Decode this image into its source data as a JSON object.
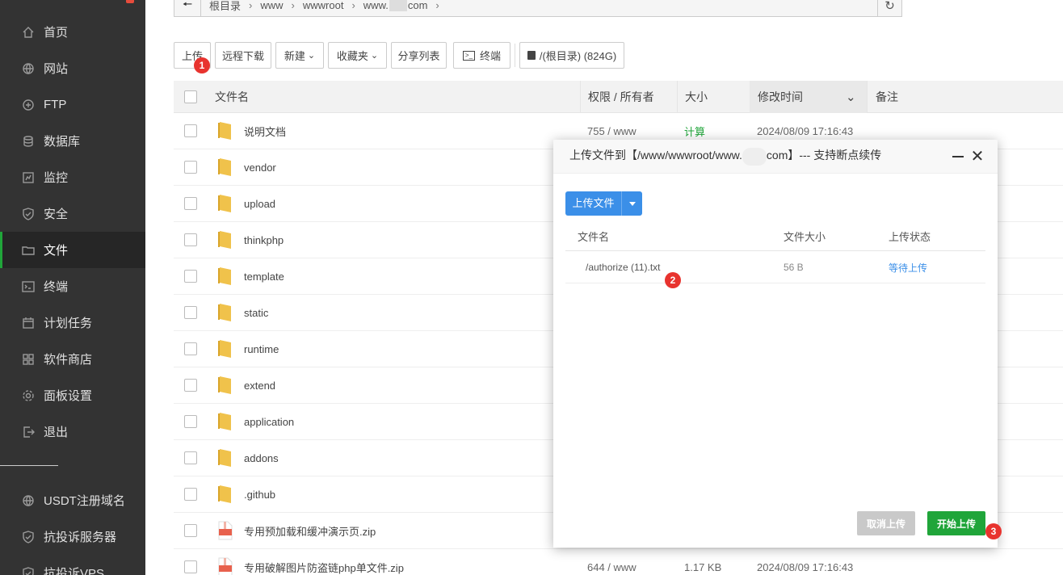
{
  "sidebar": {
    "items": [
      {
        "label": "首页",
        "icon": "home-icon"
      },
      {
        "label": "网站",
        "icon": "globe-icon"
      },
      {
        "label": "FTP",
        "icon": "ftp-icon"
      },
      {
        "label": "数据库",
        "icon": "database-icon"
      },
      {
        "label": "监控",
        "icon": "monitor-icon"
      },
      {
        "label": "安全",
        "icon": "shield-icon"
      },
      {
        "label": "文件",
        "icon": "folder-icon"
      },
      {
        "label": "终端",
        "icon": "terminal-icon"
      },
      {
        "label": "计划任务",
        "icon": "calendar-icon"
      },
      {
        "label": "软件商店",
        "icon": "apps-icon"
      },
      {
        "label": "面板设置",
        "icon": "gear-icon"
      },
      {
        "label": "退出",
        "icon": "logout-icon"
      },
      {
        "label": "USDT注册域名",
        "icon": "globe-icon"
      },
      {
        "label": "抗投诉服务器",
        "icon": "shield-icon"
      },
      {
        "label": "抗投诉VPS",
        "icon": "shield-icon"
      }
    ],
    "active_index": 6,
    "accent_color": "#20a53a"
  },
  "path": {
    "crumbs": [
      "根目录",
      "www",
      "wwwroot",
      "www.",
      "com"
    ]
  },
  "toolbar": {
    "upload": "上传",
    "remote_download": "远程下载",
    "new": "新建",
    "favorites": "收藏夹",
    "share_list": "分享列表",
    "terminal": "终端",
    "disk": "/(根目录) (824G)"
  },
  "table": {
    "headers": {
      "name": "文件名",
      "perm": "权限 / 所有者",
      "size": "大小",
      "mtime": "修改时间",
      "note": "备注"
    },
    "rows": [
      {
        "name": "说明文档",
        "type": "folder",
        "perm": "755 / www",
        "size": "计算",
        "mtime": "2024/08/09 17:16:43"
      },
      {
        "name": "vendor",
        "type": "folder"
      },
      {
        "name": "upload",
        "type": "folder"
      },
      {
        "name": "thinkphp",
        "type": "folder"
      },
      {
        "name": "template",
        "type": "folder"
      },
      {
        "name": "static",
        "type": "folder"
      },
      {
        "name": "runtime",
        "type": "folder"
      },
      {
        "name": "extend",
        "type": "folder"
      },
      {
        "name": "application",
        "type": "folder"
      },
      {
        "name": "addons",
        "type": "folder"
      },
      {
        "name": ".github",
        "type": "folder"
      },
      {
        "name": "专用预加载和缓冲演示页.zip",
        "type": "zip"
      },
      {
        "name": "专用破解图片防盗链php单文件.zip",
        "type": "zip",
        "perm": "644 / www",
        "size": "1.17 KB",
        "mtime": "2024/08/09 17:16:43"
      }
    ]
  },
  "dialog": {
    "title_prefix": "上传文件到【/www/wwwroot/www.",
    "title_suffix": "com】--- 支持断点续传",
    "upload_button": "上传文件",
    "columns": {
      "name": "文件名",
      "size": "文件大小",
      "status": "上传状态"
    },
    "file": {
      "name": "/authorize (11).txt",
      "size": "56 B",
      "status": "等待上传"
    },
    "cancel": "取消上传",
    "start": "开始上传"
  },
  "badges": [
    "1",
    "2",
    "3"
  ]
}
